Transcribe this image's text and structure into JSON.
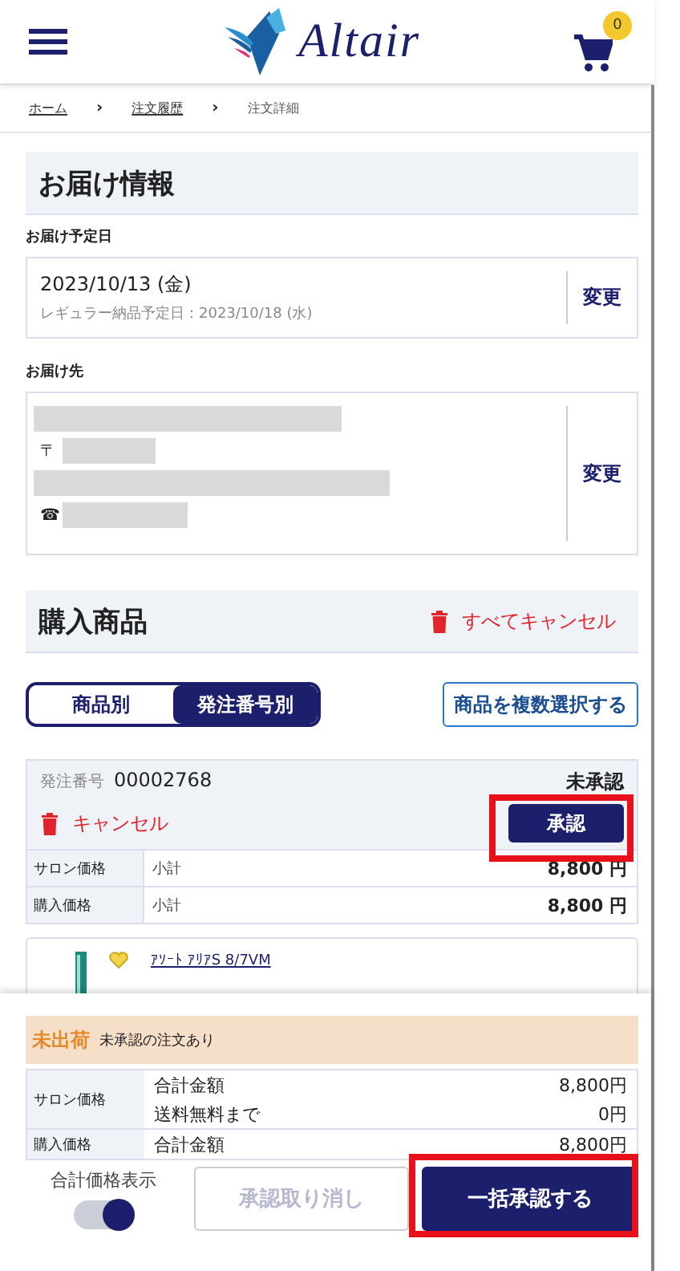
{
  "header": {
    "logo_text": "Altair",
    "cart_count": "0"
  },
  "breadcrumb": {
    "separator": "›",
    "items": [
      {
        "label": "ホーム",
        "link": true
      },
      {
        "label": "注文履歴",
        "link": true
      },
      {
        "label": "注文詳細",
        "link": false
      }
    ]
  },
  "delivery": {
    "title": "お届け情報",
    "date_label": "お届け予定日",
    "date": "2023/10/13 (金)",
    "regular_date": "レギュラー納品予定日：2023/10/18 (水)",
    "change_date": "変更",
    "address_label": "お届け先",
    "postal_mark": "〒",
    "phone_mark": "☎",
    "change_address": "変更"
  },
  "products": {
    "title": "購入商品",
    "cancel_all": "すべてキャンセル",
    "view_tabs": [
      {
        "label": "商品別",
        "selected": false
      },
      {
        "label": "発注番号別",
        "selected": true
      }
    ],
    "multi_select": "商品を複数選択する",
    "order": {
      "number_label": "発注番号",
      "number": "00002768",
      "status": "未承認",
      "cancel": "キャンセル",
      "approve": "承認",
      "approve_highlighted": true,
      "rows": [
        {
          "label": "サロン価格",
          "item": "小計",
          "amount": "8,800 円"
        },
        {
          "label": "購入価格",
          "item": "小計",
          "amount": "8,800 円"
        }
      ]
    },
    "item": {
      "name": "ｱｿｰﾄ ｱﾘｱS 8/7VM"
    }
  },
  "summary": {
    "status": "未出荷",
    "note": "未承認の注文あり",
    "rows": [
      {
        "label": "サロン価格",
        "lines": [
          {
            "item": "合計金額",
            "amount": "8,800円"
          },
          {
            "item": "送料無料まで",
            "amount": "0円"
          }
        ]
      },
      {
        "label": "購入価格",
        "lines": [
          {
            "item": "合計金額",
            "amount": "8,800円"
          }
        ]
      }
    ],
    "toggle": {
      "label": "合計価格表示",
      "on": true
    },
    "revoke": {
      "label": "承認取り消し",
      "disabled": true
    },
    "approve_all": {
      "label": "一括承認する",
      "highlighted": true
    }
  }
}
